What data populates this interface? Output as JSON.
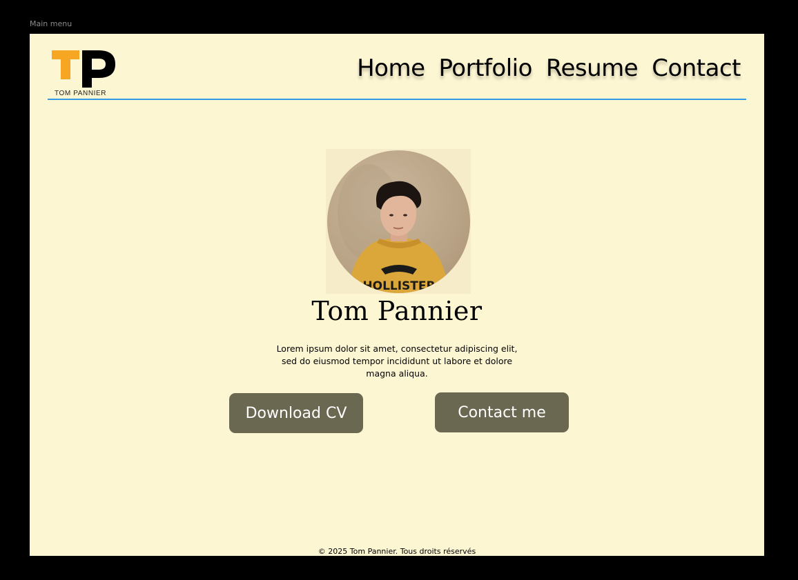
{
  "frame": {
    "label": "Main menu"
  },
  "header": {
    "logo_caption": "TOM PANNIER",
    "nav": [
      "Home",
      "Portfolio",
      "Resume",
      "Contact"
    ]
  },
  "hero": {
    "name": "Tom Pannier",
    "bio": "Lorem ipsum dolor sit amet, consectetur adipiscing elit, sed do eiusmod tempor incididunt ut labore et dolore magna aliqua.",
    "buttons": {
      "download_cv": "Download CV",
      "contact_me": "Contact me"
    }
  },
  "footer": {
    "text": "© 2025 Tom Pannier. Tous droits réservés"
  },
  "colors": {
    "background": "#fdf6d3",
    "accent_orange": "#f6a623",
    "divider_blue": "#2f9be8",
    "button": "#6b6852"
  }
}
